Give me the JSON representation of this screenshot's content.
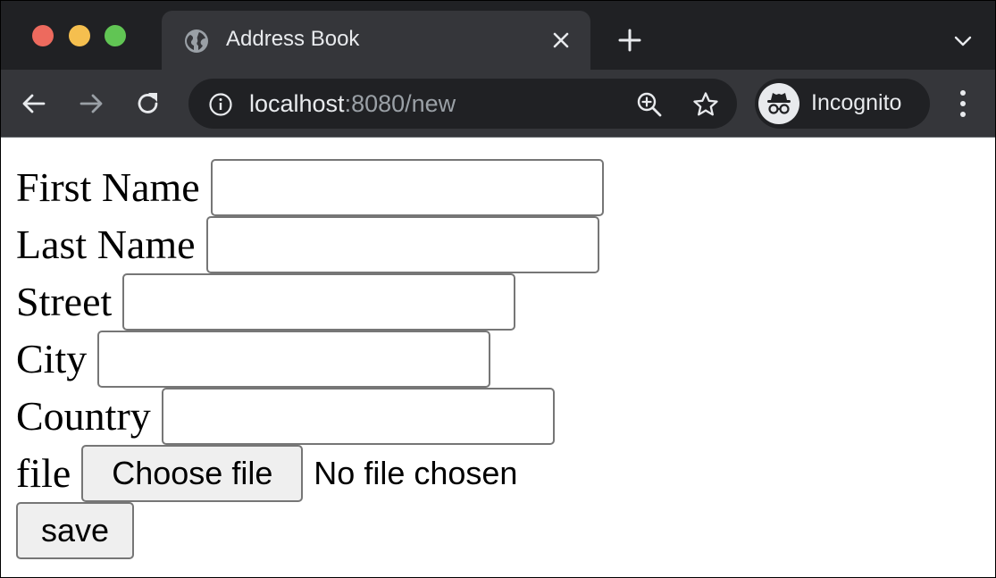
{
  "browser": {
    "tab": {
      "title": "Address Book",
      "icon": "globe-icon"
    },
    "address_bar": {
      "host": "localhost",
      "rest": ":8080/new"
    },
    "profile": {
      "label": "Incognito",
      "icon": "incognito-icon"
    },
    "colors": {
      "tabstrip": "#202124",
      "toolbar": "#35363a",
      "close": "#ed6a5e",
      "minimize": "#f5bf4f",
      "maximize": "#61c554"
    }
  },
  "form": {
    "fields": [
      {
        "label": "First Name",
        "value": "",
        "placeholder": ""
      },
      {
        "label": "Last Name",
        "value": "",
        "placeholder": ""
      },
      {
        "label": "Street",
        "value": "",
        "placeholder": ""
      },
      {
        "label": "City",
        "value": "",
        "placeholder": ""
      },
      {
        "label": "Country",
        "value": "",
        "placeholder": ""
      }
    ],
    "file": {
      "label": "file",
      "button_label": "Choose file",
      "status": "No file chosen"
    },
    "save_label": "save"
  }
}
